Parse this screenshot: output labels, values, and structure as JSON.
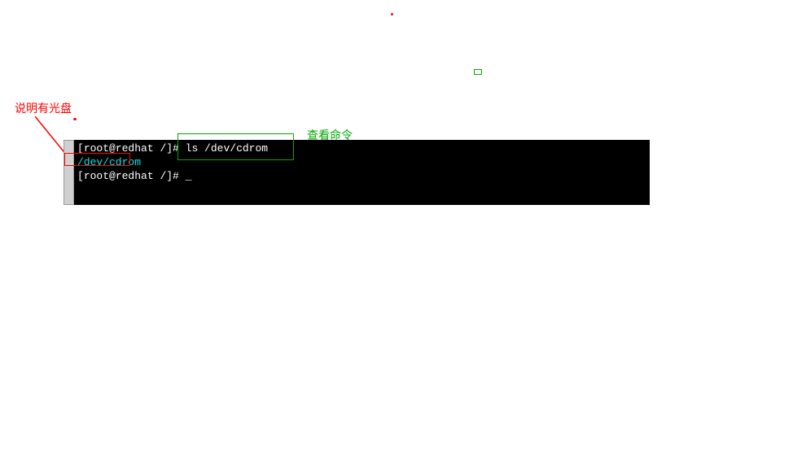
{
  "annotations": {
    "left_label": "说明有光盘",
    "top_label": "查看命令"
  },
  "terminal": {
    "line1": {
      "prompt_open": "[",
      "user_host": "root@redhat",
      "path": " /",
      "prompt_close": "]# ",
      "command": "ls /dev/cdrom"
    },
    "line2": {
      "output": "/dev/cdrom"
    },
    "line3": {
      "prompt_open": "[",
      "user_host": "root@redhat",
      "path": " /",
      "prompt_close": "]# ",
      "cursor": "_"
    }
  }
}
